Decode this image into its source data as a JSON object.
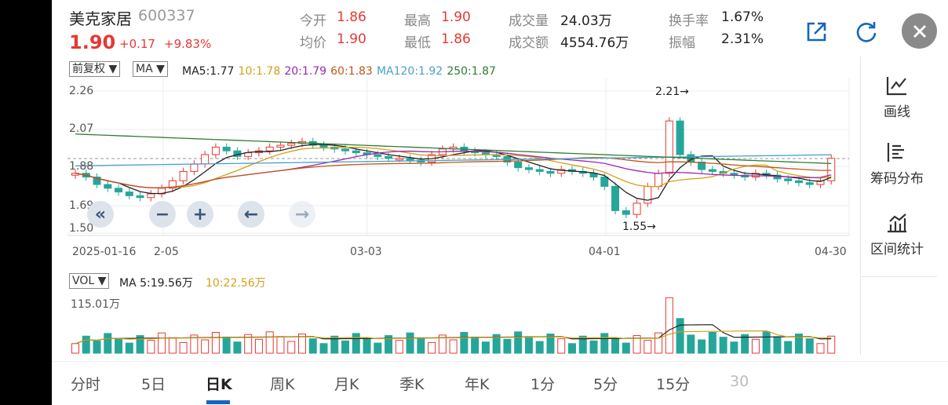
{
  "stock": {
    "name": "美克家居",
    "code": "600337",
    "price": "1.90",
    "change": "+0.17",
    "change_pct": "+9.83%"
  },
  "quote": [
    {
      "label": "今开",
      "value": "1.86"
    },
    {
      "label": "均价",
      "value": "1.90"
    },
    {
      "label": "最高",
      "value": "1.90"
    },
    {
      "label": "最低",
      "value": "1.86"
    },
    {
      "label": "成交量",
      "value": "24.03万"
    },
    {
      "label": "成交额",
      "value": "4554.76万"
    },
    {
      "label": "换手率",
      "value": "1.67%"
    },
    {
      "label": "振幅",
      "value": "2.31%"
    }
  ],
  "toolbar": {
    "adjust": "前复权",
    "indicator": "MA",
    "ma": [
      {
        "text": "MA5:1.77",
        "color": "#222222"
      },
      {
        "text": "10:1.78",
        "color": "#d4a017"
      },
      {
        "text": "20:1.79",
        "color": "#9c27b0"
      },
      {
        "text": "60:1.83",
        "color": "#c0561a"
      },
      {
        "text": "MA120:1.92",
        "color": "#4aa0c8"
      },
      {
        "text": "250:1.87",
        "color": "#2e7d32"
      }
    ]
  },
  "price_axis": [
    "2.26",
    "2.07",
    "1.88",
    "1.69",
    "1.50"
  ],
  "date_axis": [
    "2025-01-16",
    "2-05",
    "03-03",
    "04-01",
    "04-30"
  ],
  "annotations": {
    "high": "2.21",
    "low": "1.55"
  },
  "volume_bar": {
    "indicator": "VOL",
    "ma5": "MA 5:19.56万",
    "ma10": "10:22.56万",
    "max": "115.01万"
  },
  "side_panel": [
    {
      "label": "画线",
      "icon": "draw-line-icon"
    },
    {
      "label": "筹码分布",
      "icon": "chip-distribution-icon"
    },
    {
      "label": "区间统计",
      "icon": "interval-stats-icon"
    }
  ],
  "tabs": [
    "分时",
    "5日",
    "日K",
    "周K",
    "月K",
    "季K",
    "年K",
    "1分",
    "5分",
    "15分",
    "30"
  ],
  "active_tab": "日K",
  "colors": {
    "up": "#e53935",
    "down": "#26a69a",
    "accent": "#1565c0"
  }
}
